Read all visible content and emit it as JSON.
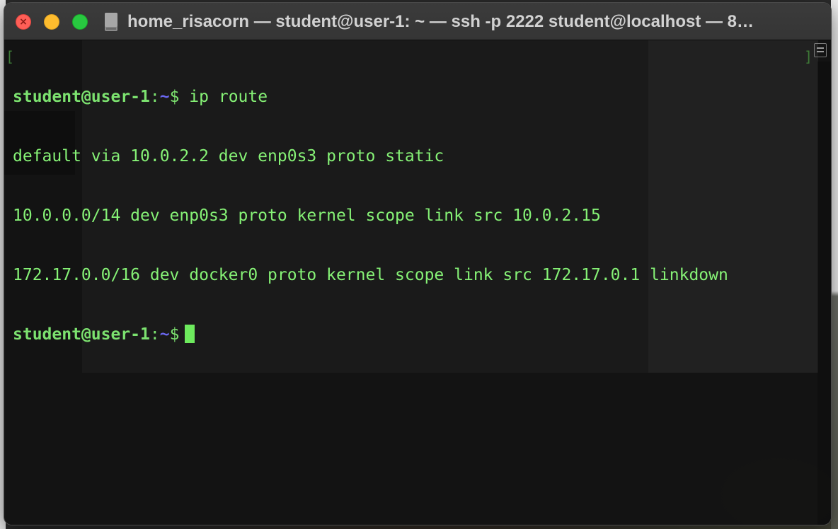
{
  "window": {
    "title": "home_risacorn — student@user-1: ~ — ssh -p 2222 student@localhost — 8…"
  },
  "traffic_lights": {
    "close_glyph": "×"
  },
  "terminal": {
    "colors": {
      "text": "#86f276",
      "prompt_path": "#6a67f0",
      "cursor": "#6dea5d",
      "background": "#141414"
    },
    "prompt": {
      "user_host": "student@user-1",
      "colon": ":",
      "path": "~",
      "dollar": "$"
    },
    "command": " ip route",
    "output": [
      "default via 10.0.2.2 dev enp0s3 proto static",
      "10.0.0.0/14 dev enp0s3 proto kernel scope link src 10.0.2.15",
      "172.17.0.0/16 dev docker0 proto kernel scope link src 172.17.0.1 linkdown"
    ],
    "left_bracket": "[",
    "right_bracket": "]"
  }
}
